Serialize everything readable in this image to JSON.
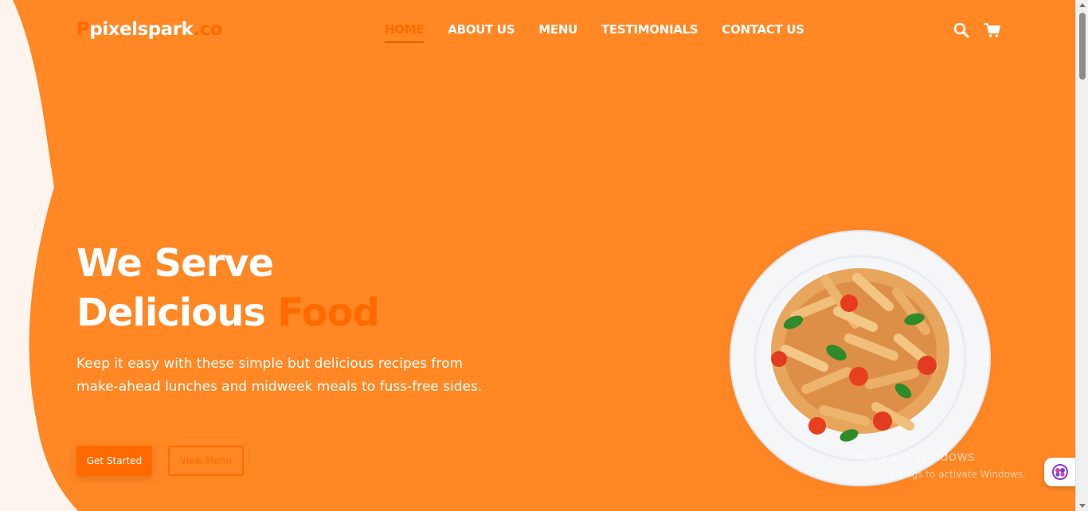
{
  "header": {
    "logo": {
      "prefix": "P",
      "name": "pixelspark",
      "tld": ".co"
    },
    "nav": [
      {
        "label": "HOME",
        "active": true
      },
      {
        "label": "ABOUT US",
        "active": false
      },
      {
        "label": "MENU",
        "active": false
      },
      {
        "label": "TESTIMONIALS",
        "active": false
      },
      {
        "label": "CONTACT US",
        "active": false
      }
    ],
    "icons": [
      "search-icon",
      "cart-icon"
    ]
  },
  "hero": {
    "title_line1": "We Serve",
    "title_line2": "Delicious",
    "title_accent": "Food",
    "description": "Keep it easy with these simple but delicious recipes from make-ahead lunches and midweek meals to fuss-free sides.",
    "primary_button": "Get Started",
    "secondary_button": "View Menu",
    "image": "pasta-plate"
  },
  "watermark": {
    "line1": "Activate Windows",
    "line2": "Go to Settings to activate Windows."
  },
  "colors": {
    "background": "#ff8724",
    "accent": "#ff6a00",
    "text": "#ffffff",
    "edge": "#fdf4ee"
  }
}
